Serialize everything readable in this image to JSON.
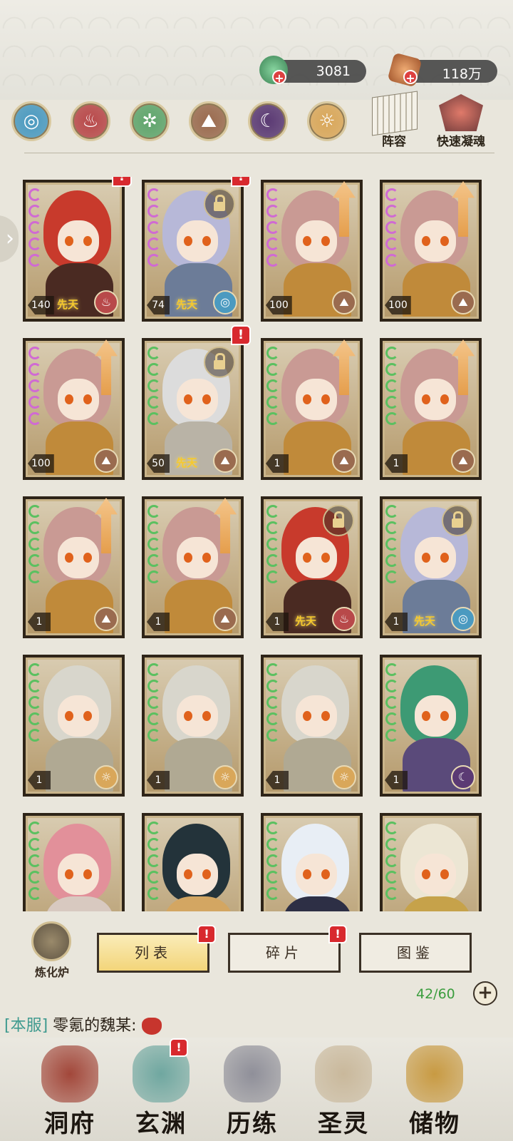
{
  "currency": [
    {
      "name": "jade",
      "value": "3081",
      "icon": "jade-coin-icon",
      "color": "#4aa86a"
    },
    {
      "name": "spirit",
      "value": "118万",
      "icon": "spirit-stone-icon",
      "color": "#c46a2e"
    }
  ],
  "elements": [
    {
      "name": "water",
      "icon": "water-swirl-icon",
      "color": "#4b9ac0",
      "glyph": "◎"
    },
    {
      "name": "fire",
      "icon": "fire-icon",
      "color": "#b8494a",
      "glyph": "♨"
    },
    {
      "name": "wood",
      "icon": "leaf-icon",
      "color": "#5fa56c",
      "glyph": "✲"
    },
    {
      "name": "earth",
      "icon": "mountain-icon",
      "color": "#9a6b4f",
      "glyph": "⛰"
    },
    {
      "name": "dark",
      "icon": "moon-icon",
      "color": "#5b3a74",
      "glyph": "☾"
    },
    {
      "name": "light",
      "icon": "sun-icon",
      "color": "#d9a75a",
      "glyph": "☼"
    }
  ],
  "tools": {
    "lineup": "阵容",
    "quick": "快速凝魂"
  },
  "cards": [
    {
      "lvl": "140",
      "element": "fire",
      "stars": "pink",
      "hair": "#c83a2c",
      "body": "#4a2a22",
      "tag": "先天",
      "lock": false,
      "up": false,
      "alert": true
    },
    {
      "lvl": "74",
      "element": "water",
      "stars": "pink",
      "hair": "#b7b8d8",
      "body": "#6c7c98",
      "tag": "先天",
      "lock": true,
      "up": false,
      "alert": true
    },
    {
      "lvl": "100",
      "element": "earth",
      "stars": "pink",
      "hair": "#c99a94",
      "body": "#c08a3a",
      "tag": "",
      "lock": false,
      "up": true,
      "alert": false
    },
    {
      "lvl": "100",
      "element": "earth",
      "stars": "pink",
      "hair": "#c99a94",
      "body": "#c08a3a",
      "tag": "",
      "lock": false,
      "up": true,
      "alert": false
    },
    {
      "lvl": "100",
      "element": "earth",
      "stars": "pink",
      "hair": "#c99a94",
      "body": "#c08a3a",
      "tag": "",
      "lock": false,
      "up": true,
      "alert": false
    },
    {
      "lvl": "50",
      "element": "earth",
      "stars": "green",
      "hair": "#dcdcdc",
      "body": "#b9b3a6",
      "tag": "先天",
      "lock": true,
      "up": false,
      "alert": true
    },
    {
      "lvl": "1",
      "element": "earth",
      "stars": "green",
      "hair": "#c99a94",
      "body": "#c08a3a",
      "tag": "",
      "lock": false,
      "up": true,
      "alert": false
    },
    {
      "lvl": "1",
      "element": "earth",
      "stars": "green",
      "hair": "#c99a94",
      "body": "#c08a3a",
      "tag": "",
      "lock": false,
      "up": true,
      "alert": false
    },
    {
      "lvl": "1",
      "element": "earth",
      "stars": "green",
      "hair": "#c99a94",
      "body": "#c08a3a",
      "tag": "",
      "lock": false,
      "up": true,
      "alert": false
    },
    {
      "lvl": "1",
      "element": "earth",
      "stars": "green",
      "hair": "#c99a94",
      "body": "#c08a3a",
      "tag": "",
      "lock": false,
      "up": true,
      "alert": false
    },
    {
      "lvl": "1",
      "element": "fire",
      "stars": "green",
      "hair": "#c83a2c",
      "body": "#4a2a22",
      "tag": "先天",
      "lock": true,
      "up": false,
      "alert": false
    },
    {
      "lvl": "1",
      "element": "water",
      "stars": "green",
      "hair": "#b7b8d8",
      "body": "#6c7c98",
      "tag": "先天",
      "lock": true,
      "up": false,
      "alert": false
    },
    {
      "lvl": "1",
      "element": "light",
      "stars": "green",
      "hair": "#d8d6cc",
      "body": "#b0a993",
      "tag": "",
      "lock": false,
      "up": false,
      "alert": false
    },
    {
      "lvl": "1",
      "element": "light",
      "stars": "green",
      "hair": "#d8d6cc",
      "body": "#b0a993",
      "tag": "",
      "lock": false,
      "up": false,
      "alert": false
    },
    {
      "lvl": "1",
      "element": "light",
      "stars": "green",
      "hair": "#d8d6cc",
      "body": "#b0a993",
      "tag": "",
      "lock": false,
      "up": false,
      "alert": false
    },
    {
      "lvl": "1",
      "element": "dark",
      "stars": "green",
      "hair": "#3d9a74",
      "body": "#5a4a7a",
      "tag": "",
      "lock": false,
      "up": false,
      "alert": false
    },
    {
      "lvl": "",
      "element": "",
      "stars": "green",
      "hair": "#e2909a",
      "body": "#d8c9c0",
      "tag": "",
      "lock": false,
      "up": false,
      "alert": false
    },
    {
      "lvl": "",
      "element": "",
      "stars": "green",
      "hair": "#23333a",
      "body": "#d3a662",
      "tag": "",
      "lock": false,
      "up": false,
      "alert": false
    },
    {
      "lvl": "",
      "element": "",
      "stars": "green",
      "hair": "#e8eef5",
      "body": "#2d2f45",
      "tag": "",
      "lock": false,
      "up": false,
      "alert": false
    },
    {
      "lvl": "",
      "element": "",
      "stars": "green",
      "hair": "#ece6d4",
      "body": "#c6a24a",
      "tag": "",
      "lock": false,
      "up": false,
      "alert": false
    }
  ],
  "furnace": "炼化炉",
  "tabs": [
    {
      "label": "列表",
      "active": true,
      "alert": true
    },
    {
      "label": "碎片",
      "active": false,
      "alert": true
    },
    {
      "label": "图鉴",
      "active": false,
      "alert": false
    }
  ],
  "capacity": "42/60",
  "chat": {
    "server": "[本服]",
    "message": "零氪的魏某:"
  },
  "nav": [
    {
      "label": "洞府",
      "icon": "gate-icon",
      "color": "#a2473a",
      "alert": false
    },
    {
      "label": "玄渊",
      "icon": "lotus-icon",
      "color": "#6fa7a0",
      "alert": true
    },
    {
      "label": "历练",
      "icon": "sword-icon",
      "color": "#8f8f99",
      "alert": false
    },
    {
      "label": "圣灵",
      "icon": "tiger-icon",
      "color": "#c9b89b",
      "alert": false
    },
    {
      "label": "储物",
      "icon": "bag-icon",
      "color": "#c89a42",
      "alert": false
    }
  ]
}
